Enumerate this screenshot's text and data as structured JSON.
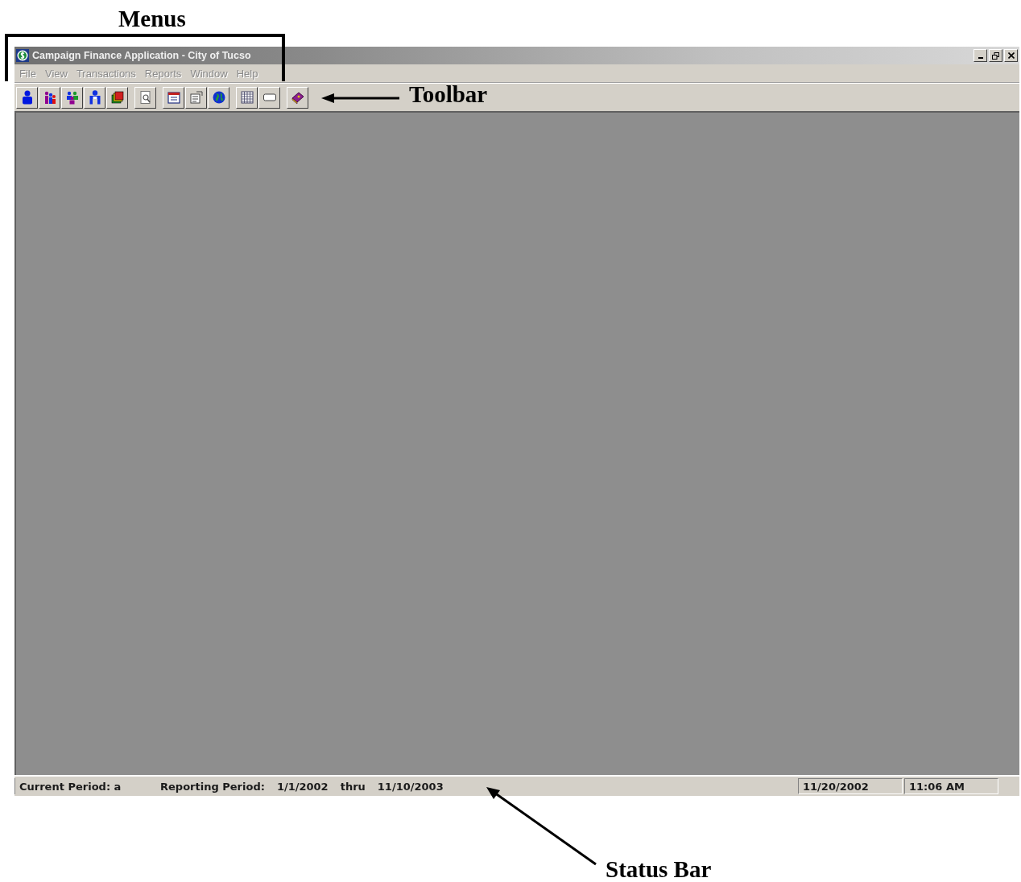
{
  "callouts": {
    "menus": "Menus",
    "toolbar": "Toolbar",
    "status_bar": "Status Bar"
  },
  "window": {
    "title": "Campaign Finance Application - City of Tucso",
    "active": false
  },
  "menu_bar": [
    {
      "label": "File",
      "disabled": true
    },
    {
      "label": "View",
      "disabled": true
    },
    {
      "label": "Transactions",
      "disabled": true
    },
    {
      "label": "Reports",
      "disabled": true
    },
    {
      "label": "Window",
      "disabled": true
    },
    {
      "label": "Help",
      "disabled": true
    }
  ],
  "status_bar": {
    "current_period": "Current Period: a",
    "reporting_period_label": "Reporting Period:",
    "period_start": "1/1/2002",
    "thru": "thru",
    "period_end": "11/10/2003",
    "date": "11/20/2002",
    "time": "11:06 AM"
  }
}
